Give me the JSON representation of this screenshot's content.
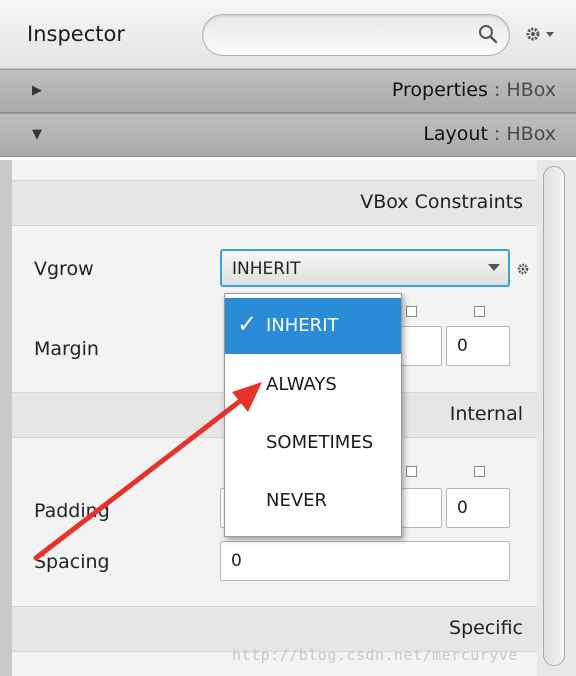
{
  "header": {
    "title": "Inspector",
    "search_placeholder": "",
    "icons": {
      "search": "search-icon",
      "settings": "gear-icon"
    }
  },
  "sections": {
    "properties": {
      "label": "Properties",
      "separator": " : ",
      "type": "HBox",
      "expanded": false
    },
    "layout": {
      "label": "Layout",
      "separator": " : ",
      "type": "HBox",
      "expanded": true
    }
  },
  "vbox_constraints": {
    "title": "VBox Constraints",
    "vgrow_label": "Vgrow",
    "vgrow_value": "INHERIT",
    "margin_label": "Margin",
    "margin_right_value": "0"
  },
  "internal": {
    "title": "Internal",
    "padding_label": "Padding",
    "padding_right_value": "0",
    "spacing_label": "Spacing",
    "spacing_value": "0"
  },
  "specific": {
    "title": "Specific"
  },
  "dropdown": {
    "options": [
      "INHERIT",
      "ALWAYS",
      "SOMETIMES",
      "NEVER"
    ],
    "selected": "INHERIT",
    "check_glyph": "✓"
  },
  "watermark": "http://blog.csdn.net/mercuryve",
  "colors": {
    "accent": "#2a8bd6",
    "focus_border": "#3e9fd9",
    "annotation_arrow": "#e8312a"
  }
}
